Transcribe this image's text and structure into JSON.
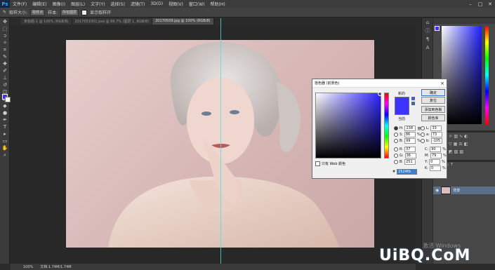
{
  "app": {
    "logo": "Ps"
  },
  "menubar": {
    "items": [
      "文件(F)",
      "编辑(E)",
      "图像(I)",
      "图层(L)",
      "文字(Y)",
      "选择(S)",
      "滤镜(T)",
      "3D(D)",
      "视图(V)",
      "窗口(W)",
      "帮助(H)"
    ]
  },
  "window_controls": {
    "minimize": "–",
    "maximize": "□",
    "close": "✕"
  },
  "options_bar": {
    "sample_size_label": "取样大小:",
    "sample_size_value": "取样点",
    "sample_label": "样本:",
    "sample_value": "所有图层",
    "show_ring_label": "显示取样环"
  },
  "document_tabs": [
    "未标题-1 @ 100% (RGB/8)",
    "2017051001.psd @ 66.7% (图层 1, RGB/8)",
    "20170509.jpg @ 100% (RGB/8)"
  ],
  "statusbar": {
    "zoom": "100%",
    "doc": "文档:1.74M/1.74M"
  },
  "picker": {
    "title": "拾色器 (前景色)",
    "new_label": "新的",
    "current_label": "当前",
    "buttons": {
      "ok": "确定",
      "cancel": "复位",
      "add_swatch": "添加到色板",
      "libraries": "颜色库"
    },
    "fields": {
      "h": {
        "label": "H:",
        "value": "238",
        "unit": "度"
      },
      "s": {
        "label": "S:",
        "value": "86",
        "unit": "%"
      },
      "b": {
        "label": "B:",
        "value": "99",
        "unit": "%"
      },
      "r": {
        "label": "R:",
        "value": "37",
        "unit": ""
      },
      "g": {
        "label": "G:",
        "value": "36",
        "unit": ""
      },
      "bl": {
        "label": "B:",
        "value": "251",
        "unit": ""
      },
      "l": {
        "label": "L:",
        "value": "33",
        "unit": ""
      },
      "a": {
        "label": "a:",
        "value": "73",
        "unit": ""
      },
      "bb": {
        "label": "b:",
        "value": "-105",
        "unit": ""
      },
      "c": {
        "label": "C:",
        "value": "90",
        "unit": "%"
      },
      "m": {
        "label": "M:",
        "value": "79",
        "unit": "%"
      },
      "y": {
        "label": "Y:",
        "value": "0",
        "unit": "%"
      },
      "k": {
        "label": "K:",
        "value": "0",
        "unit": "%"
      }
    },
    "web_only_label": "只有 Web 颜色",
    "hex_label": "#",
    "hex_value": "2524fb"
  },
  "colors": {
    "foreground": "#3c34fc",
    "background": "#ffffff",
    "guide": "#4ee0e6"
  },
  "layers": {
    "layer_name": "背景"
  },
  "watermarks": {
    "windows": "激活 Windows",
    "site": "UiBQ.CoM"
  }
}
